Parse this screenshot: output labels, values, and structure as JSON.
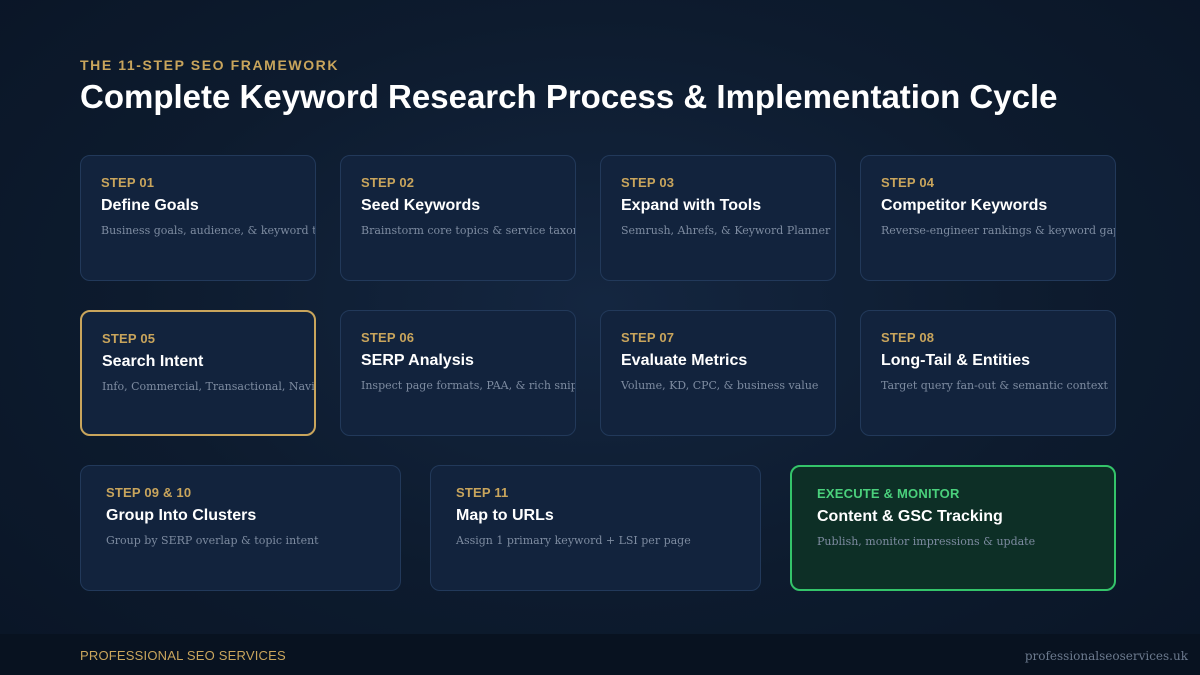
{
  "header": {
    "eyebrow": "THE 11-STEP SEO FRAMEWORK",
    "title": "Complete Keyword Research Process & Implementation Cycle"
  },
  "steps": [
    {
      "step": "STEP 01",
      "name": "Define Goals",
      "desc": "Business goals, audience, & keyword types"
    },
    {
      "step": "STEP 02",
      "name": "Seed Keywords",
      "desc": "Brainstorm core topics & service taxonomy"
    },
    {
      "step": "STEP 03",
      "name": "Expand with Tools",
      "desc": "Semrush, Ahrefs, & Keyword Planner"
    },
    {
      "step": "STEP 04",
      "name": "Competitor Keywords",
      "desc": "Reverse-engineer rankings & keyword gaps"
    },
    {
      "step": "STEP 05",
      "name": "Search Intent",
      "desc": "Info, Commercial, Transactional, Navigational"
    },
    {
      "step": "STEP 06",
      "name": "SERP Analysis",
      "desc": "Inspect page formats, PAA, & rich snippets"
    },
    {
      "step": "STEP 07",
      "name": "Evaluate Metrics",
      "desc": "Volume, KD, CPC, & business value"
    },
    {
      "step": "STEP 08",
      "name": "Long-Tail & Entities",
      "desc": "Target query fan-out & semantic context"
    },
    {
      "step": "STEP 09 & 10",
      "name": "Group Into Clusters",
      "desc": "Group by SERP overlap & topic intent"
    },
    {
      "step": "STEP 11",
      "name": "Map to URLs",
      "desc": "Assign 1 primary keyword + LSI per page"
    },
    {
      "step": "EXECUTE & MONITOR",
      "name": "Content & GSC Tracking",
      "desc": "Publish, monitor impressions & update"
    }
  ],
  "footer": {
    "brand": "PROFESSIONAL SEO SERVICES",
    "url": "professionalseoservices.uk"
  },
  "colors": {
    "accent_gold": "#c9a55c",
    "accent_green": "#34c46a",
    "card_bg": "#12233d",
    "background": "#0d1b2e"
  }
}
